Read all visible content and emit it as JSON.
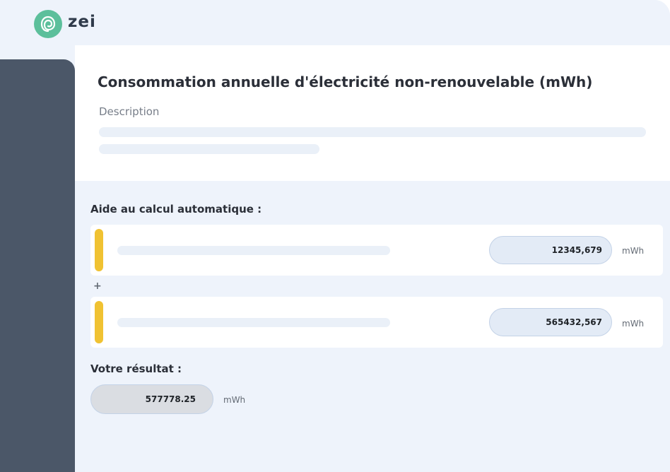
{
  "brand": {
    "name": "zei",
    "logo_icon": "leaf-spiral-icon",
    "color": "#5cbf9b"
  },
  "card": {
    "title": "Consommation annuelle d'électricité non-renouvelable (mWh)",
    "description_label": "Description"
  },
  "calc": {
    "label": "Aide au calcul automatique :",
    "operator": "+",
    "rows": [
      {
        "value": "12345,679",
        "unit": "mWh"
      },
      {
        "value": "565432,567",
        "unit": "mWh"
      }
    ],
    "accent_color": "#f0c232"
  },
  "result": {
    "label": "Votre résultat :",
    "value": "577778.25",
    "unit": "mWh"
  }
}
